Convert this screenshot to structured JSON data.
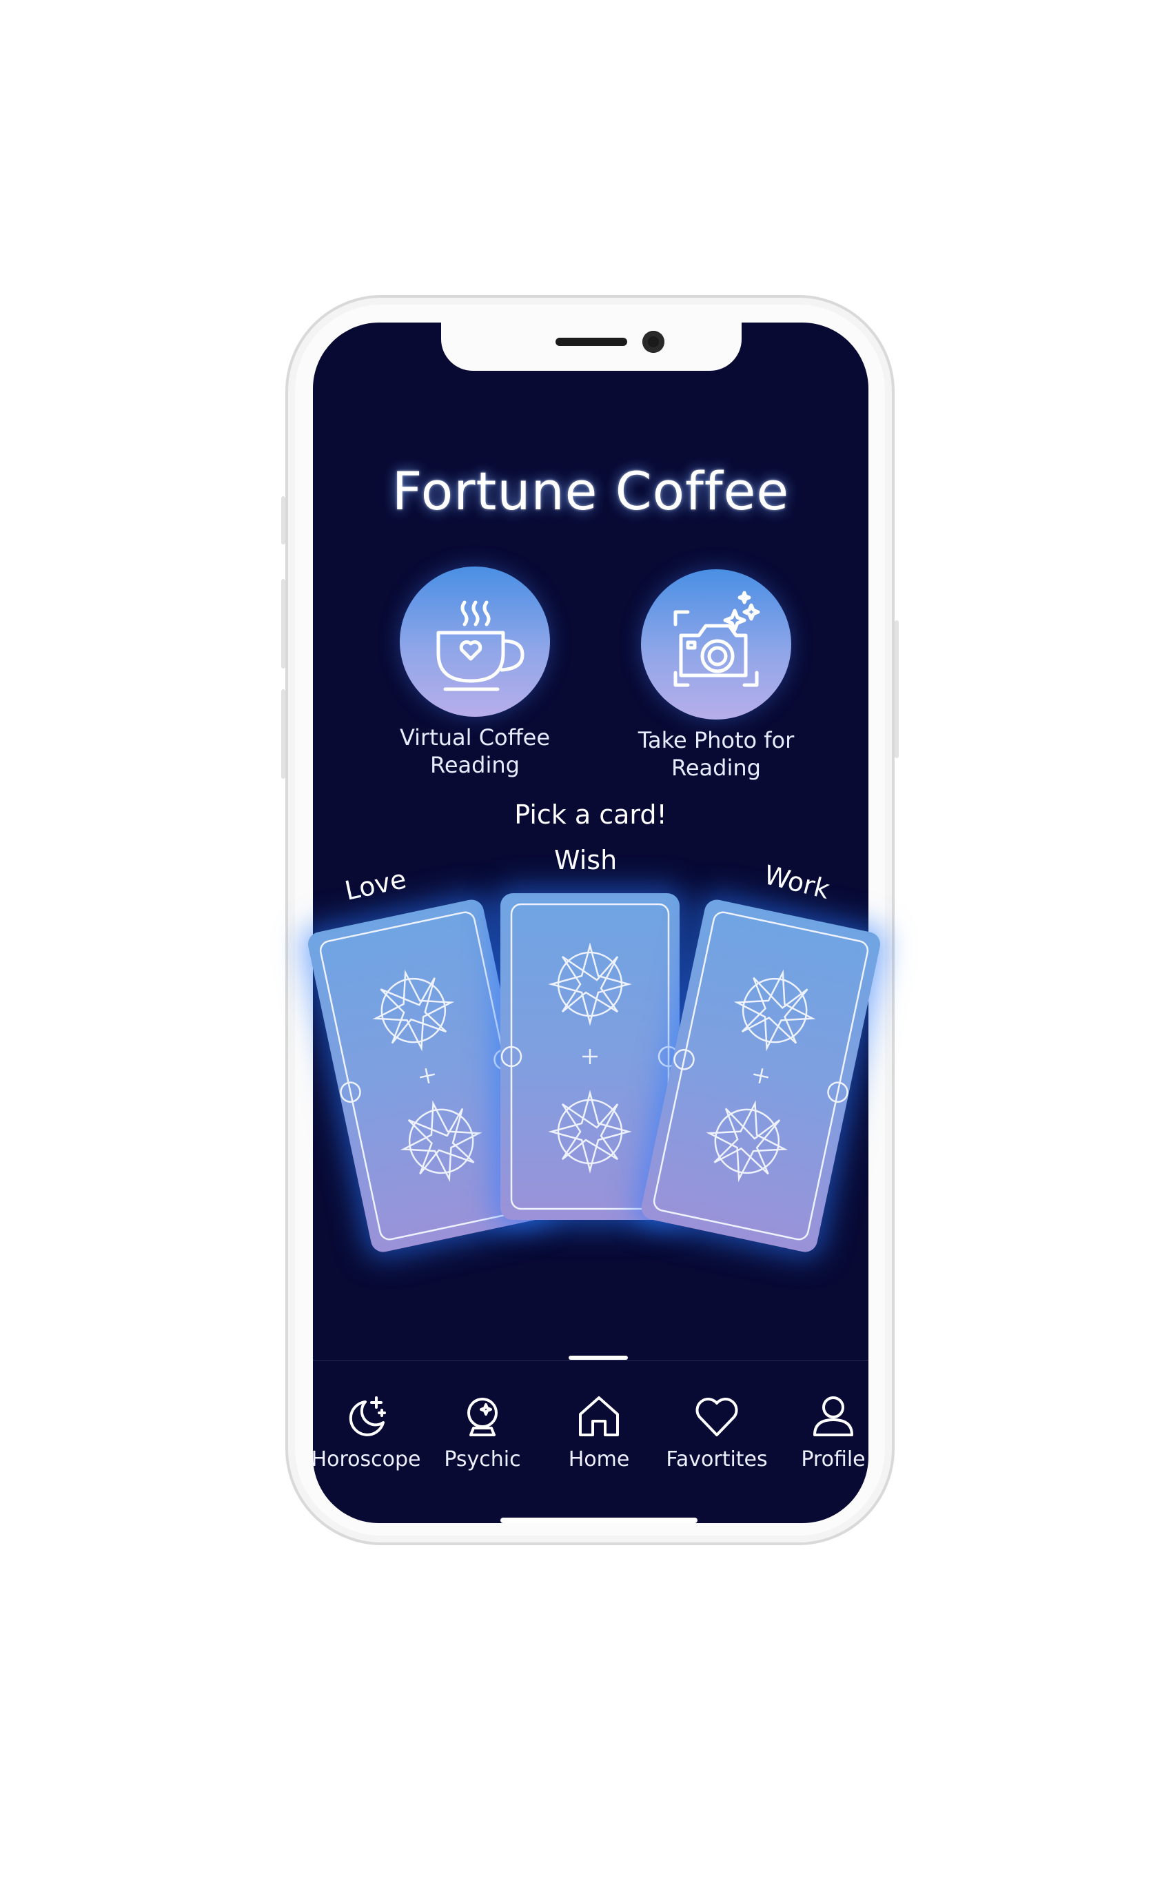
{
  "app": {
    "title": "Fortune Coffee"
  },
  "actions": [
    {
      "label_line1": "Virtual Coffee",
      "label_line2": "Reading",
      "icon": "coffee-cup-icon"
    },
    {
      "label_line1": "Take Photo for",
      "label_line2": "Reading",
      "icon": "camera-sparkle-icon"
    }
  ],
  "cards_section": {
    "prompt": "Pick a card!",
    "cards": [
      {
        "label": "Love"
      },
      {
        "label": "Wish"
      },
      {
        "label": "Work"
      }
    ]
  },
  "nav": {
    "items": [
      {
        "label": "Horoscope",
        "icon": "moon-stars-icon"
      },
      {
        "label": "Psychic",
        "icon": "crystal-ball-icon"
      },
      {
        "label": "Home",
        "icon": "home-icon",
        "active": true
      },
      {
        "label": "Favortites",
        "icon": "heart-icon"
      },
      {
        "label": "Profile",
        "icon": "user-icon"
      }
    ]
  },
  "colors": {
    "screen_bg": "#080a34",
    "accent": "#4a8fe4",
    "card": "#7f9fe0"
  }
}
